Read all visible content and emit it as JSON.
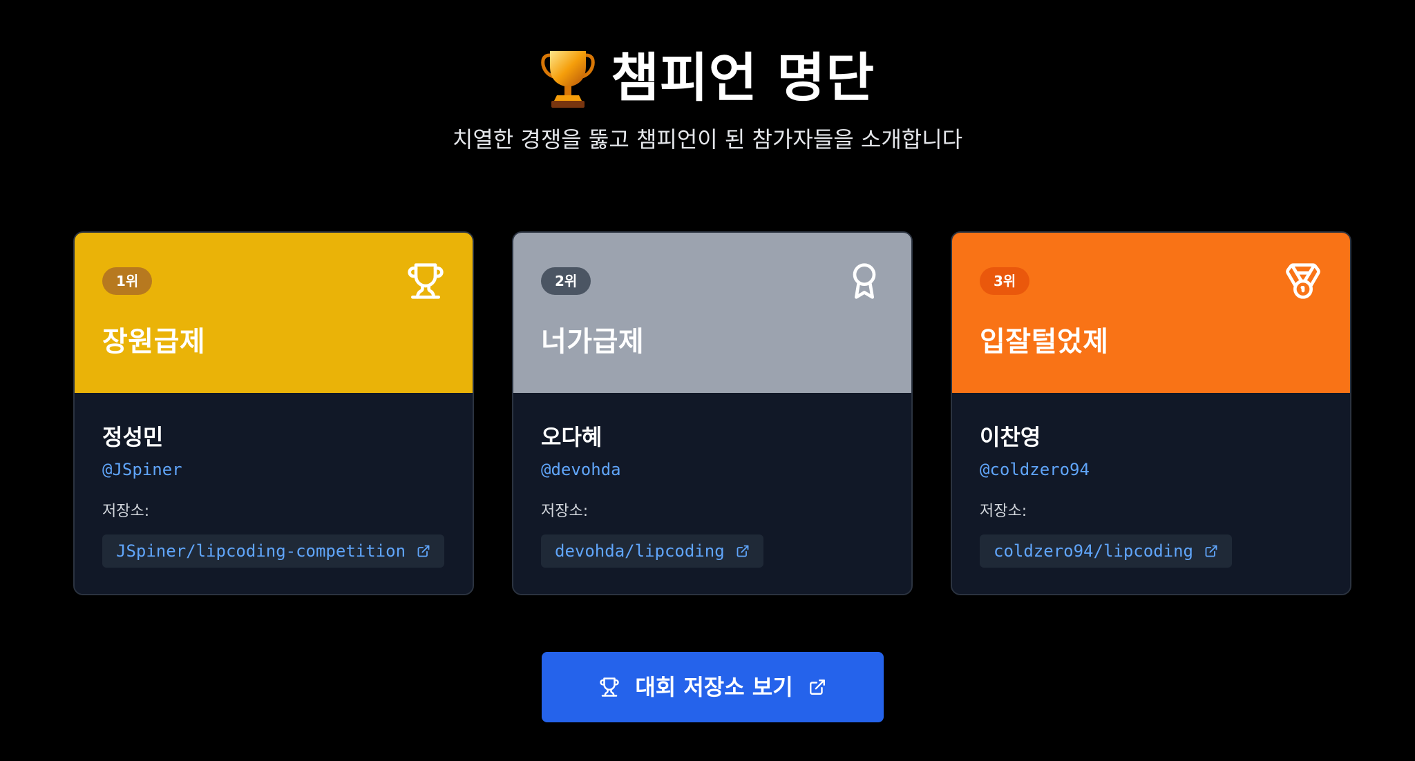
{
  "header": {
    "title_emoji": "🏆",
    "title": "챔피언 명단",
    "subtitle": "치열한 경쟁을 뚫고 챔피언이 된 참가자들을 소개합니다"
  },
  "colors": {
    "background": "#000000",
    "card_body": "#111827",
    "gold": "#eab308",
    "silver": "#9ca3af",
    "bronze": "#f97316",
    "link": "#60a5fa",
    "button": "#2563eb"
  },
  "champions": [
    {
      "rank_label": "1위",
      "rank_icon": "trophy-icon",
      "team": "장원급제",
      "name": "정성민",
      "handle": "@JSpiner",
      "repo_label": "저장소:",
      "repo": "JSpiner/lipcoding-competition"
    },
    {
      "rank_label": "2위",
      "rank_icon": "award-icon",
      "team": "너가급제",
      "name": "오다혜",
      "handle": "@devohda",
      "repo_label": "저장소:",
      "repo": "devohda/lipcoding"
    },
    {
      "rank_label": "3위",
      "rank_icon": "medal-icon",
      "team": "입잘털었제",
      "name": "이찬영",
      "handle": "@coldzero94",
      "repo_label": "저장소:",
      "repo": "coldzero94/lipcoding"
    }
  ],
  "cta": {
    "label": "대회 저장소 보기",
    "icon": "trophy-icon",
    "trailing_icon": "external-link-icon"
  }
}
